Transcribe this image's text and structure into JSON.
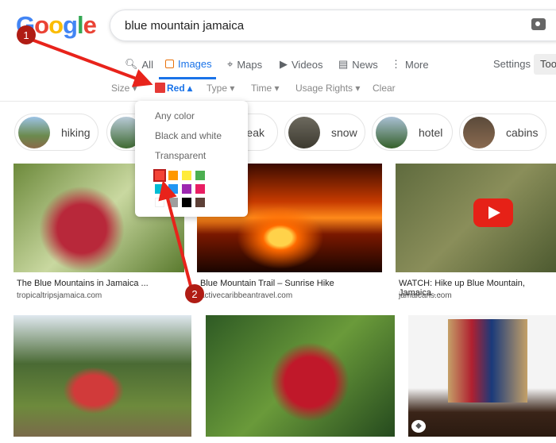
{
  "logo": {
    "letters": [
      "G",
      "o",
      "o",
      "g",
      "l",
      "e"
    ],
    "colors": [
      "#4285f4",
      "#ea4335",
      "#fbbc05",
      "#4285f4",
      "#34a853",
      "#ea4335"
    ]
  },
  "search": {
    "value": "blue mountain jamaica",
    "icon": "camera-icon"
  },
  "tabs": [
    {
      "label": "All",
      "icon": "search-icon"
    },
    {
      "label": "Images",
      "icon": "image-icon",
      "active": true
    },
    {
      "label": "Maps",
      "icon": "map-pin-icon"
    },
    {
      "label": "Videos",
      "icon": "play-icon"
    },
    {
      "label": "News",
      "icon": "news-icon"
    },
    {
      "label": "More",
      "icon": "more-vertical-icon"
    }
  ],
  "settings": "Settings",
  "tools": "Too",
  "filters": {
    "size": "Size ▾",
    "color": "Red ▴",
    "type": "Type ▾",
    "time": "Time ▾",
    "usage": "Usage Rights ▾",
    "clear": "Clear",
    "selected_color": "#e53935"
  },
  "chips": [
    {
      "label": "hiking"
    },
    {
      "label": ""
    },
    {
      "label": "eak"
    },
    {
      "label": "snow"
    },
    {
      "label": "hotel"
    },
    {
      "label": "cabins"
    }
  ],
  "color_menu": {
    "options": [
      "Any color",
      "Black and white",
      "Transparent"
    ],
    "swatches": [
      "#f44336",
      "#ff9800",
      "#ffeb3b",
      "#4caf50",
      "#00bcd4",
      "#2196f3",
      "#9c27b0",
      "#e91e63",
      "#ffffff",
      "#9e9e9e",
      "#000000",
      "#5d4037"
    ]
  },
  "results": [
    {
      "caption": "The Blue Mountains in Jamaica ...",
      "source": "tropicaltripsjamaica.com"
    },
    {
      "caption": "Blue Mountain Trail – Sunrise Hike",
      "source": "activecaribbeantravel.com"
    },
    {
      "caption": "WATCH: Hike up Blue Mountain, Jamaica ...",
      "source": "jamaicans.com"
    }
  ],
  "annotations": {
    "step1": "1",
    "step2": "2",
    "color": "#e8231b"
  }
}
